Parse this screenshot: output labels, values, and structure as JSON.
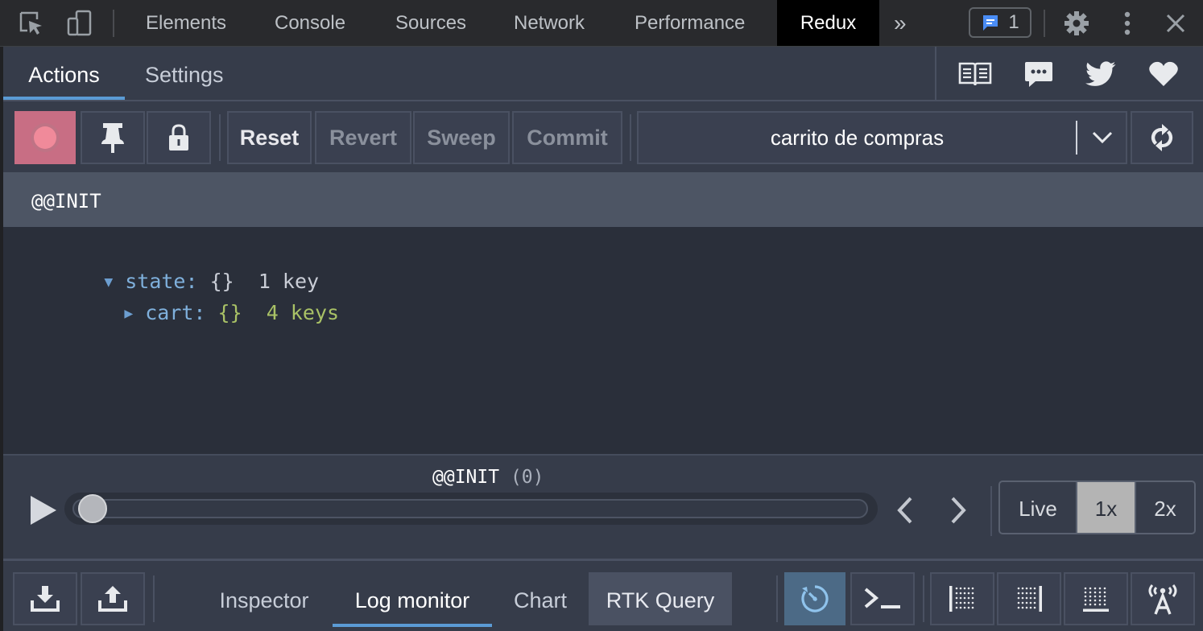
{
  "devtools": {
    "tabs": [
      "Elements",
      "Console",
      "Sources",
      "Network",
      "Performance",
      "Redux"
    ],
    "active_tab": "Redux",
    "overflow_label": "»",
    "issues_count": "1",
    "icons": [
      "inspect-element-icon",
      "device-toolbar-icon",
      "more-tabs-icon",
      "issues-message-icon",
      "settings-gear-icon",
      "kebab-menu-icon",
      "close-icon"
    ]
  },
  "redux": {
    "subtabs": [
      "Actions",
      "Settings"
    ],
    "active_subtab": "Actions",
    "header_links": [
      "documentation-book-icon",
      "feedback-chat-icon",
      "twitter-bird-icon",
      "heart-sponsor-icon"
    ],
    "toolbar": {
      "record_color": "#f08a9a",
      "buttons": {
        "reset": "Reset",
        "revert": "Revert",
        "sweep": "Sweep",
        "commit": "Commit"
      },
      "instance": "carrito de compras",
      "icons": [
        "record-icon",
        "pin-icon",
        "lock-icon",
        "chevron-down-icon",
        "sync-icon"
      ]
    },
    "action": {
      "name": "@@INIT"
    },
    "state_tree": {
      "root_key": "state:",
      "root_value": "{}",
      "root_count": "1 key",
      "child_key": "cart:",
      "child_value": "{}",
      "child_count": "4 keys"
    },
    "slider": {
      "label": "@@INIT",
      "index": "(0)",
      "position": 0,
      "speeds": [
        "Live",
        "1x",
        "2x"
      ],
      "selected_speed": "1x",
      "icons": [
        "play-icon",
        "step-back-icon",
        "step-forward-icon"
      ]
    },
    "bottom": {
      "monitors": [
        "Inspector",
        "Log monitor",
        "Chart",
        "RTK Query"
      ],
      "active_monitor": "Log monitor",
      "icons": [
        "import-download-icon",
        "export-upload-icon",
        "persist-timer-icon",
        "terminal-dispatcher-icon",
        "dock-left-icon",
        "dock-right-icon",
        "dock-bottom-icon",
        "remote-broadcast-icon"
      ]
    },
    "colors": {
      "accent": "#5b9bd5",
      "panel": "#2a2f3a",
      "toolbar": "#363c4a",
      "keys_blue": "#7fb0dc",
      "values_green": "#a9c266"
    }
  }
}
